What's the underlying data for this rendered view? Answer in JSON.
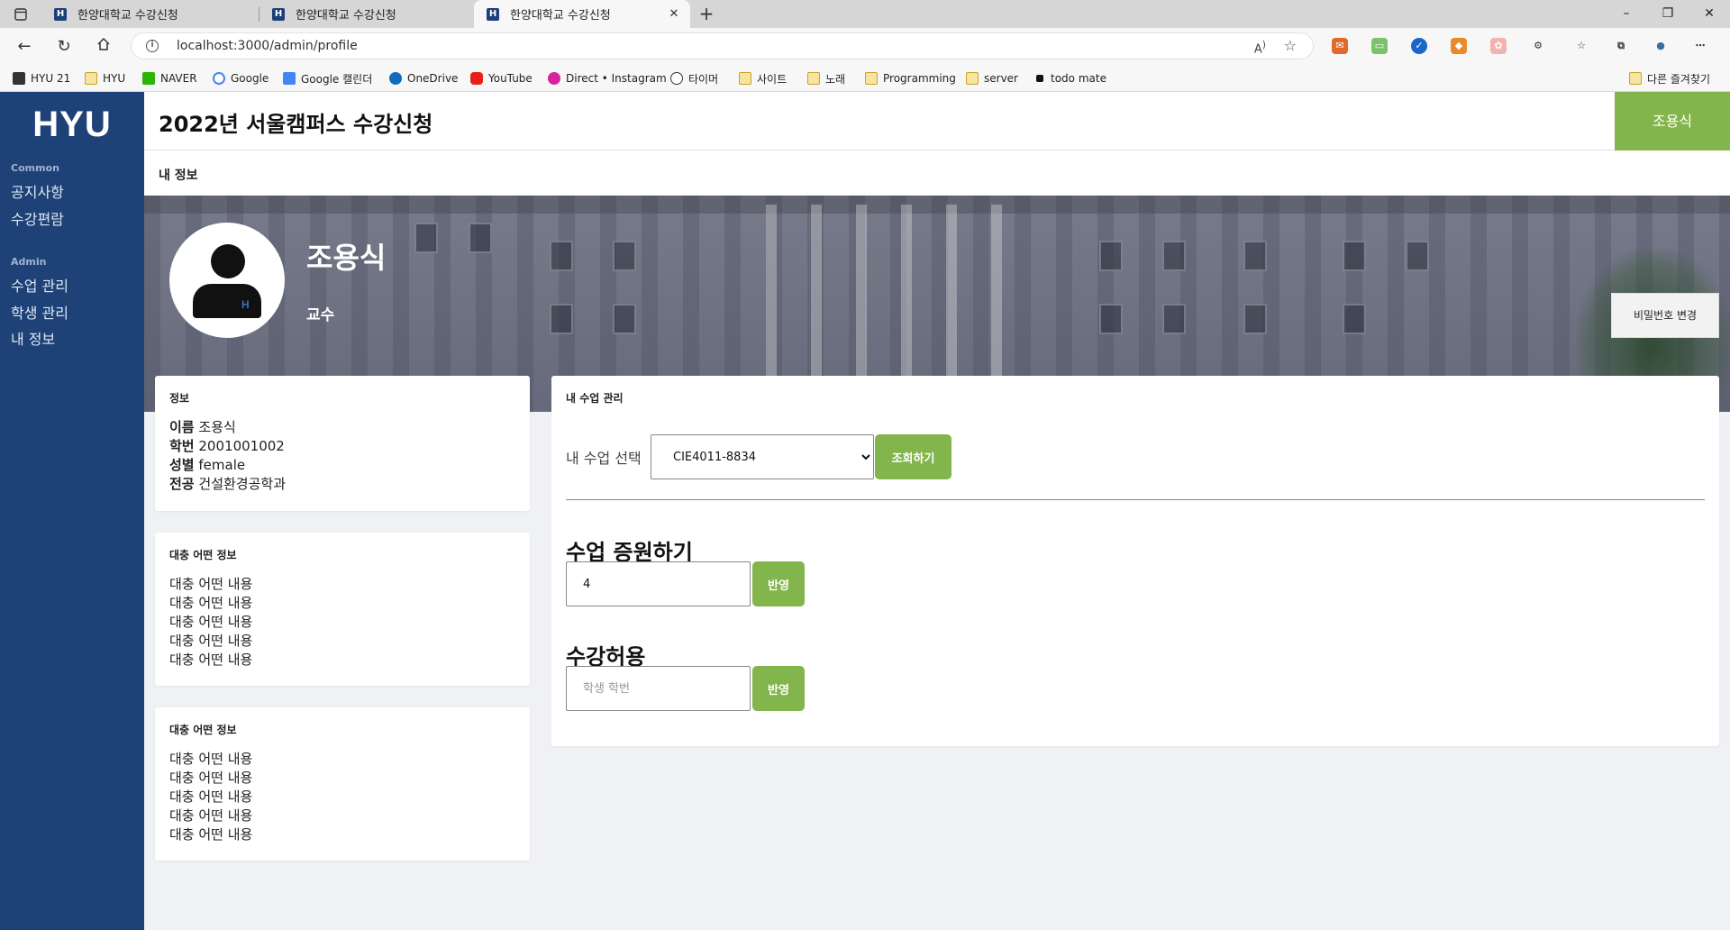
{
  "browser": {
    "tabs": [
      {
        "title": "한양대학교 수강신청",
        "favicon": "H"
      },
      {
        "title": "한양대학교 수강신청",
        "favicon": "H"
      },
      {
        "title": "한양대학교 수강신청",
        "favicon": "H"
      }
    ],
    "url": "localhost:3000/admin/profile",
    "bookmarks": [
      {
        "label": "HYU 21",
        "icon": "hyu21-icon"
      },
      {
        "label": "HYU",
        "icon": "folder-icon"
      },
      {
        "label": "NAVER",
        "icon": "naver-icon"
      },
      {
        "label": "Google",
        "icon": "google-icon"
      },
      {
        "label": "Google 캘린더",
        "icon": "calendar-icon"
      },
      {
        "label": "OneDrive",
        "icon": "onedrive-icon"
      },
      {
        "label": "YouTube",
        "icon": "youtube-icon"
      },
      {
        "label": "Direct • Instagram",
        "icon": "instagram-icon"
      },
      {
        "label": "타이머",
        "icon": "timer-icon"
      },
      {
        "label": "사이트",
        "icon": "folder-icon"
      },
      {
        "label": "노래",
        "icon": "folder-icon"
      },
      {
        "label": "Programming",
        "icon": "folder-icon"
      },
      {
        "label": "server",
        "icon": "folder-icon"
      },
      {
        "label": "todo mate",
        "icon": "todomate-icon"
      }
    ],
    "other_bookmarks": "다른 즐겨찾기"
  },
  "sidebar": {
    "logo": "HYU",
    "sections": [
      {
        "title": "Common",
        "items": [
          "공지사항",
          "수강편람"
        ]
      },
      {
        "title": "Admin",
        "items": [
          "수업 관리",
          "학생 관리",
          "내 정보"
        ]
      }
    ]
  },
  "header": {
    "title": "2022년 서울캠퍼스 수강신청",
    "user_button": "조용식"
  },
  "breadcrumb": "내 정보",
  "profile": {
    "name": "조용식",
    "role": "교수",
    "avatar_badge": "H",
    "change_password": "비밀번호 변경"
  },
  "info_card": {
    "title": "정보",
    "fields": [
      {
        "label": "이름",
        "value": "조용식"
      },
      {
        "label": "학번",
        "value": "2001001002"
      },
      {
        "label": "성별",
        "value": "female"
      },
      {
        "label": "전공",
        "value": "건설환경공학과"
      }
    ]
  },
  "misc_cards": [
    {
      "title": "대충 어떤 정보",
      "lines": [
        "대충 어떤 내용",
        "대충 어떤 내용",
        "대충 어떤 내용",
        "대충 어떤 내용",
        "대충 어떤 내용"
      ]
    },
    {
      "title": "대충 어떤 정보",
      "lines": [
        "대충 어떤 내용",
        "대충 어떤 내용",
        "대충 어떤 내용",
        "대충 어떤 내용",
        "대충 어떤 내용"
      ]
    }
  ],
  "manage": {
    "title": "내 수업 관리",
    "select_label": "내 수업 선택",
    "selected_course": "CIE4011-8834",
    "query_button": "조회하기",
    "increase": {
      "heading": "수업 증원하기",
      "value": "4",
      "button": "반영"
    },
    "permit": {
      "heading": "수강허용",
      "placeholder": "학생 학번",
      "button": "반영"
    }
  },
  "colors": {
    "sidebar_bg": "#1e4277",
    "accent_green": "#82b54b",
    "page_bg": "#f0f1f5"
  }
}
